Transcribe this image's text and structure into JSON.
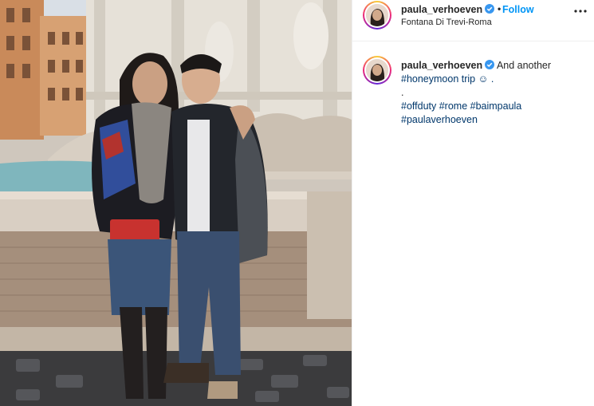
{
  "post": {
    "username": "paula_verhoeven",
    "verified": true,
    "separator": "•",
    "follow_label": "Follow",
    "location": "Fontana Di Trevi-Roma",
    "more_icon": "more-horizontal-icon"
  },
  "caption": {
    "username": "paula_verhoeven",
    "line1": "And another",
    "line2": "#honeymoon trip ☺ .",
    "line3": ".",
    "line4": "#offduty #rome #baimpaula",
    "line5": "#paulaverhoeven"
  },
  "colors": {
    "link_blue": "#0095f6",
    "hashtag_blue": "#00376b",
    "verified_blue": "#3897f0",
    "text": "#262626",
    "divider": "#efefef"
  }
}
